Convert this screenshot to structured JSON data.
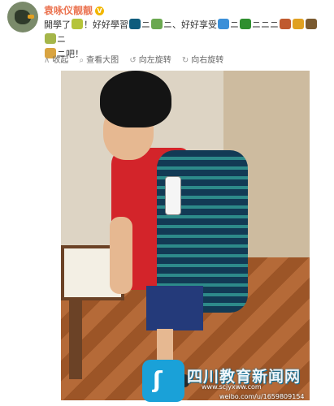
{
  "user": {
    "name": "袁咏仪靓靓"
  },
  "post": {
    "text_parts": [
      "開學了",
      "！好好學習",
      "ニ",
      "ニ、好好享受",
      "ニ",
      "ニニニ",
      "ニ",
      "ニ",
      "吧！"
    ]
  },
  "toolbar": {
    "collapse": "收起",
    "view_large": "查看大图",
    "rotate_left": "向左旋转",
    "rotate_right": "向右旋转"
  },
  "watermark": {
    "title": "四川教育新闻网",
    "url": "www.scjyxww.com",
    "source": "weibo.com/u/1659809154"
  },
  "colors": {
    "username": "#eb7350",
    "logo": "#1aa1d8",
    "emoji": [
      "#b5c43a",
      "#0d5c7d",
      "#6aa84f",
      "#3a8fd8",
      "#2f8f2f",
      "#c05a2e",
      "#e0a020",
      "#7a5a30",
      "#a5b64a",
      "#d9a441"
    ]
  }
}
